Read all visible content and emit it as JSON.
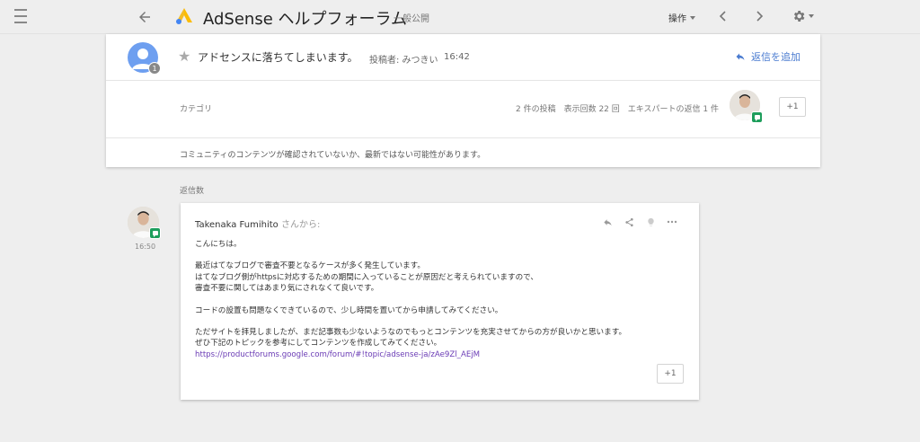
{
  "header": {
    "app_title": "AdSense ヘルプフォーラム",
    "visibility": "一般公開",
    "ops_label": "操作"
  },
  "topic": {
    "title": "アドセンスに落ちてしまいます。",
    "author_label": "投稿者: みつきい",
    "time": "16:42",
    "avatar_count": "1",
    "reply_add_label": "返信を追加",
    "category_label": "カテゴリ",
    "stats": "2 件の投稿　表示回数 22 回　エキスパートの返信 1 件",
    "plus_one": "+1",
    "notice": "コミュニティのコンテンツが確認されていないか、最新ではない可能性があります。"
  },
  "replies_label": "返信数",
  "reply": {
    "author": "Takenaka Fumihito",
    "from_suffix": "さんから:",
    "time": "16:50",
    "greeting": "こんにちは。",
    "para1_line1": "最近はてなブログで審査不要となるケースが多く発生しています。",
    "para1_line2": "はてなブログ側がhttpsに対応するための期間に入っていることが原因だと考えられていますので、",
    "para1_line3": "審査不要に関してはあまり気にされなくて良いです。",
    "para2": "コードの設置も問題なくできているので、少し時間を置いてから申請してみてください。",
    "para3_line1": "ただサイトを拝見しましたが、まだ記事数も少ないようなのでもっとコンテンツを充実させてからの方が良いかと思います。",
    "para3_line2": "ぜひ下記のトピックを参考にしてコンテンツを作成してみてください。",
    "link": "https://productforums.google.com/forum/#!topic/adsense-ja/zAe9Zl_AEjM",
    "plus_one": "+1"
  },
  "colors": {
    "accent_blue": "#4a7bd0",
    "expert_green": "#1e9e5c",
    "link_purple": "#6a3bb5",
    "background": "#eeeeee"
  }
}
